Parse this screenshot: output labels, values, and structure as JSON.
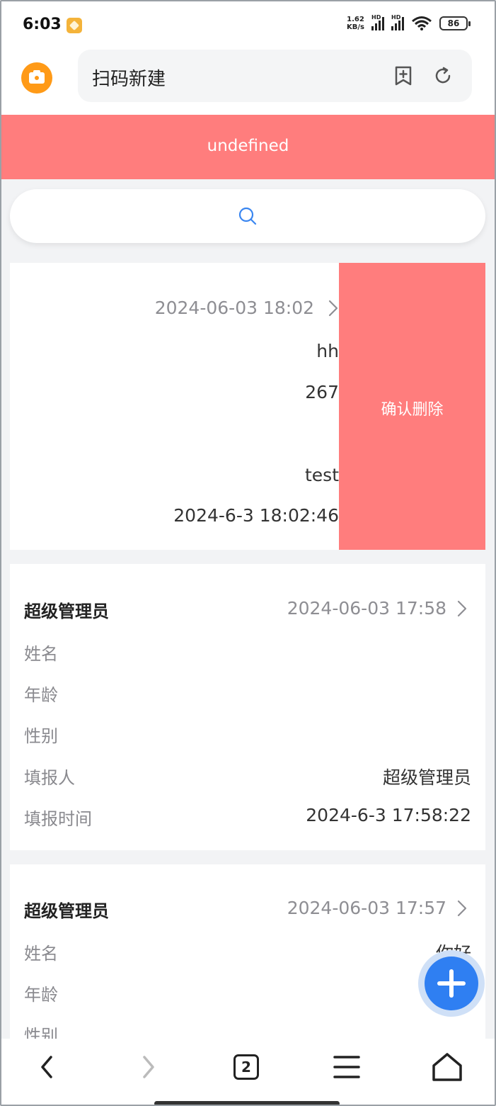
{
  "status_bar": {
    "time": "6:03",
    "net_speed_value": "1.62",
    "net_speed_unit": "KB/s",
    "signal_label": "HD",
    "battery": "86"
  },
  "browser": {
    "url_text": "扫码新建",
    "tab_count": "2"
  },
  "header": {
    "title": "undefined"
  },
  "search": {
    "icon": "search-icon"
  },
  "records": [
    {
      "date": "2024-06-03 18:02",
      "values": [
        "hh",
        "267",
        "",
        "test",
        "2024-6-3 18:02:46"
      ],
      "delete_label": "确认删除"
    },
    {
      "title": "超级管理员",
      "date": "2024-06-03 17:58",
      "fields": [
        {
          "label": "姓名",
          "value": ""
        },
        {
          "label": "年龄",
          "value": ""
        },
        {
          "label": "性别",
          "value": ""
        },
        {
          "label": "填报人",
          "value": "超级管理员"
        },
        {
          "label": "填报时间",
          "value": "2024-6-3 17:58:22"
        }
      ]
    },
    {
      "title": "超级管理员",
      "date": "2024-06-03 17:57",
      "fields": [
        {
          "label": "姓名",
          "value": "你好"
        },
        {
          "label": "年龄",
          "value": ""
        },
        {
          "label": "性别",
          "value": ""
        }
      ]
    }
  ],
  "colors": {
    "accent_red": "#ff7d7d",
    "fab_blue": "#2f7ff2",
    "camera_orange": "#ff9a17"
  }
}
